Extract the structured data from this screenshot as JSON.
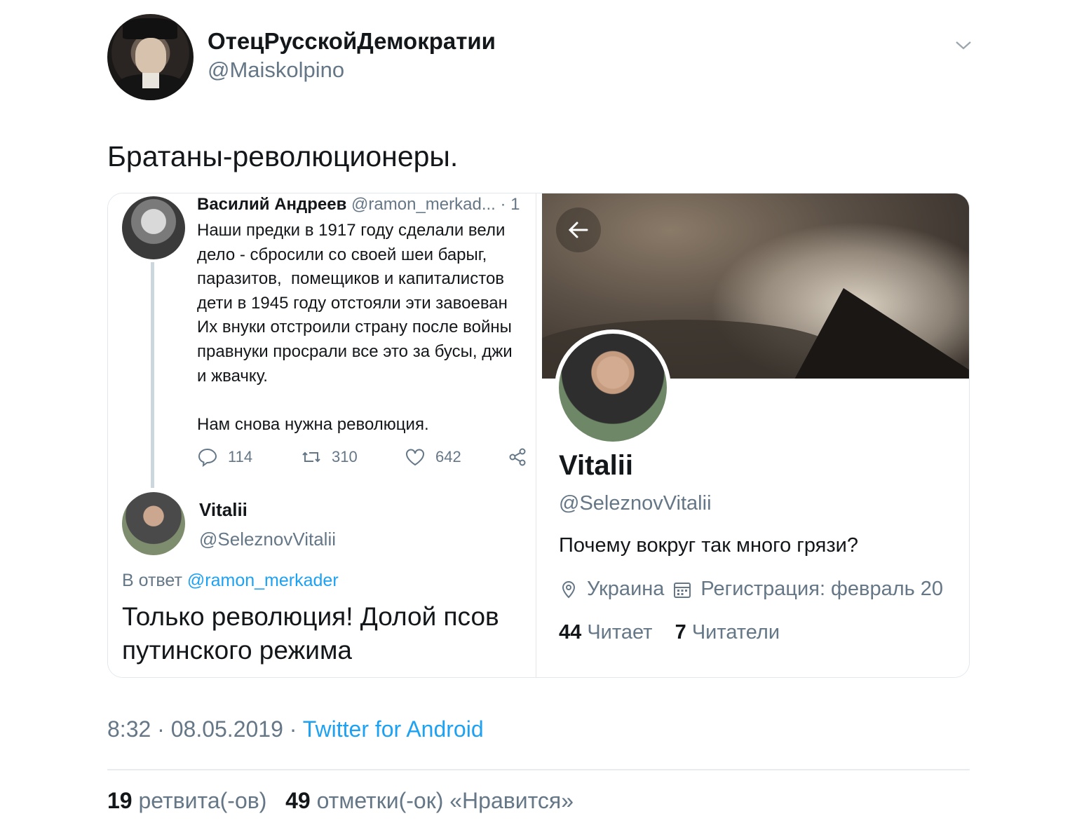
{
  "author": {
    "display_name": "ОтецРусскойДемократии",
    "handle": "@Maiskolpino"
  },
  "tweet": {
    "text": "Братаны-революционеры.",
    "time": "8:32",
    "date": "08.05.2019",
    "separator": " · ",
    "source": "Twitter for Android",
    "retweets_count": "19",
    "retweets_label": "ретвита(-ов)",
    "likes_count": "49",
    "likes_label": "отметки(-ок) «Нравится»"
  },
  "screenshot_left": {
    "original": {
      "name": "Василий Андреев",
      "handle_meta": "@ramon_merkad... · 1",
      "body": "Наши предки в 1917 году сделали вели\nдело - сбросили со своей шеи барыг,\nпаразитов,  помещиков и капиталистов\nдети в 1945 году отстояли эти завоеван\nИх внуки отстроили страну после войны\nправнуки просрали все это за бусы, джи\nи жвачку.\n\nНам снова нужна революция.",
      "replies": "114",
      "retweets": "310",
      "likes": "642"
    },
    "reply": {
      "name": "Vitalii",
      "handle": "@SeleznovVitalii",
      "reply_to_prefix": "В ответ ",
      "reply_to_handle": "@ramon_merkader",
      "text": "Только революция! Долой псов путинского режима"
    }
  },
  "screenshot_right": {
    "name": "Vitalii",
    "handle": "@SeleznovVitalii",
    "bio": "Почему вокруг так много грязи?",
    "location": "Украина",
    "joined": "Регистрация: февраль 20",
    "following_count": "44",
    "following_label": "Читает",
    "followers_count": "7",
    "followers_label": "Читатели"
  },
  "colors": {
    "link": "#1da1f2",
    "secondary_text": "#657786",
    "primary_text": "#14171a"
  },
  "icons": [
    "chevron-down-icon",
    "reply-icon",
    "retweet-icon",
    "like-icon",
    "share-icon",
    "back-arrow-icon",
    "location-icon",
    "calendar-icon"
  ]
}
